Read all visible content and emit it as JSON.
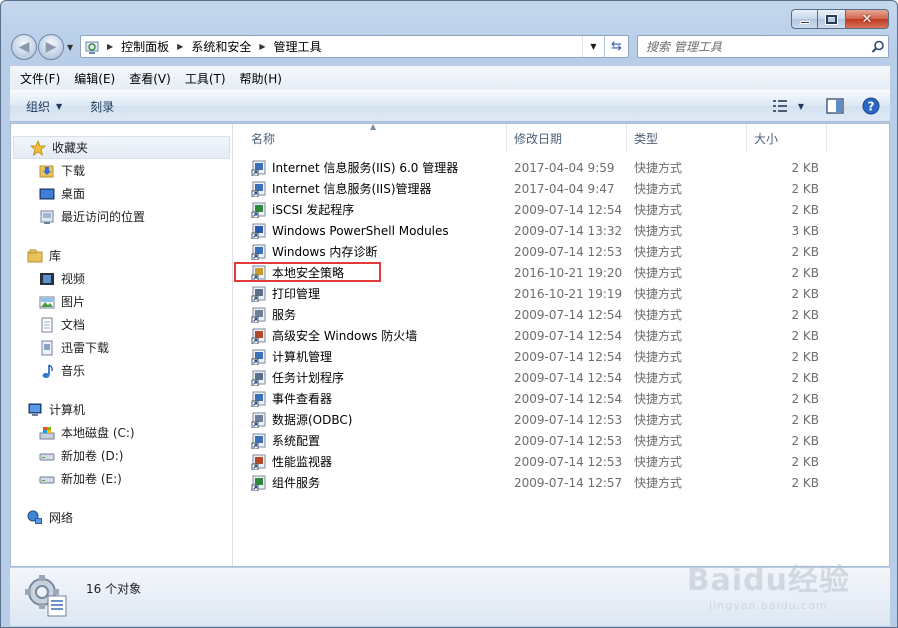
{
  "window": {
    "caption": {
      "minimize": "minimize",
      "maximize": "maximize",
      "close": "close"
    }
  },
  "address": {
    "crumbs": [
      "控制面板",
      "系统和安全",
      "管理工具"
    ]
  },
  "search": {
    "placeholder": "搜索 管理工具"
  },
  "menu": [
    "文件(F)",
    "编辑(E)",
    "查看(V)",
    "工具(T)",
    "帮助(H)"
  ],
  "commands": {
    "organize": "组织",
    "burn": "刻录"
  },
  "nav": {
    "favorites": {
      "label": "收藏夹",
      "items": [
        "下载",
        "桌面",
        "最近访问的位置"
      ]
    },
    "libraries": {
      "label": "库",
      "items": [
        "视频",
        "图片",
        "文档",
        "迅雷下载",
        "音乐"
      ]
    },
    "computer": {
      "label": "计算机",
      "items": [
        "本地磁盘 (C:)",
        "新加卷 (D:)",
        "新加卷 (E:)"
      ]
    },
    "network": {
      "label": "网络"
    }
  },
  "columns": {
    "name": "名称",
    "date": "修改日期",
    "type": "类型",
    "size": "大小"
  },
  "files": [
    {
      "name": "Internet 信息服务(IIS) 6.0 管理器",
      "date": "2017-04-04 9:59",
      "type": "快捷方式",
      "size": "2 KB"
    },
    {
      "name": "Internet 信息服务(IIS)管理器",
      "date": "2017-04-04 9:47",
      "type": "快捷方式",
      "size": "2 KB"
    },
    {
      "name": "iSCSI 发起程序",
      "date": "2009-07-14 12:54",
      "type": "快捷方式",
      "size": "2 KB"
    },
    {
      "name": "Windows PowerShell Modules",
      "date": "2009-07-14 13:32",
      "type": "快捷方式",
      "size": "3 KB"
    },
    {
      "name": "Windows 内存诊断",
      "date": "2009-07-14 12:53",
      "type": "快捷方式",
      "size": "2 KB"
    },
    {
      "name": "本地安全策略",
      "date": "2016-10-21 19:20",
      "type": "快捷方式",
      "size": "2 KB"
    },
    {
      "name": "打印管理",
      "date": "2016-10-21 19:19",
      "type": "快捷方式",
      "size": "2 KB"
    },
    {
      "name": "服务",
      "date": "2009-07-14 12:54",
      "type": "快捷方式",
      "size": "2 KB"
    },
    {
      "name": "高级安全 Windows 防火墙",
      "date": "2009-07-14 12:54",
      "type": "快捷方式",
      "size": "2 KB"
    },
    {
      "name": "计算机管理",
      "date": "2009-07-14 12:54",
      "type": "快捷方式",
      "size": "2 KB"
    },
    {
      "name": "任务计划程序",
      "date": "2009-07-14 12:54",
      "type": "快捷方式",
      "size": "2 KB"
    },
    {
      "name": "事件查看器",
      "date": "2009-07-14 12:54",
      "type": "快捷方式",
      "size": "2 KB"
    },
    {
      "name": "数据源(ODBC)",
      "date": "2009-07-14 12:53",
      "type": "快捷方式",
      "size": "2 KB"
    },
    {
      "name": "系统配置",
      "date": "2009-07-14 12:53",
      "type": "快捷方式",
      "size": "2 KB"
    },
    {
      "name": "性能监视器",
      "date": "2009-07-14 12:53",
      "type": "快捷方式",
      "size": "2 KB"
    },
    {
      "name": "组件服务",
      "date": "2009-07-14 12:57",
      "type": "快捷方式",
      "size": "2 KB"
    }
  ],
  "highlighted_file_index": 5,
  "status": {
    "count_text": "16 个对象"
  },
  "watermark": {
    "brand": "Baidu经验",
    "url": "jingyan.baidu.com"
  },
  "colors": {
    "accent": "#1e395b",
    "highlight": "#e03a3a",
    "folder": "#e8c15a"
  }
}
